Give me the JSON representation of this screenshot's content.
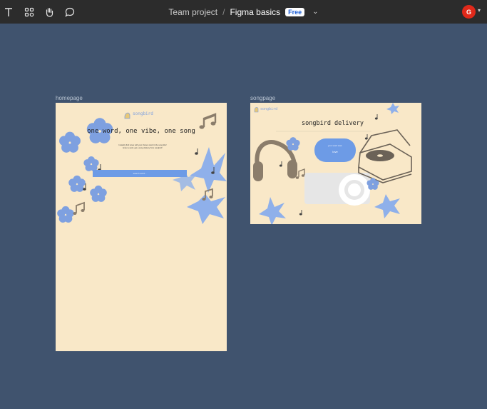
{
  "toolbar": {
    "tools": [
      {
        "name": "text-tool",
        "icon": "text-icon"
      },
      {
        "name": "resources-tool",
        "icon": "resources-icon"
      },
      {
        "name": "hand-tool",
        "icon": "hand-icon"
      },
      {
        "name": "comment-tool",
        "icon": "comment-icon"
      }
    ],
    "breadcrumb": {
      "team": "Team project",
      "separator": "/",
      "file": "Figma basics",
      "badge": "Free"
    },
    "avatar_initial": "G",
    "avatar_color": "#e0291a"
  },
  "frames": {
    "homepage": {
      "label": "homepage",
      "logo": "songbird",
      "title": "one word, one vibe, one song",
      "description_line1": "Instantly find tunes with your chosen word in the song title!",
      "description_line2": "Enter a word, get a song delivery from songbird!",
      "search_placeholder": "search word..."
    },
    "songpage": {
      "label": "songpage",
      "logo": "songbird",
      "title": "songbird delivery",
      "bubble_text": "your word was:",
      "bubble_word": "love"
    }
  },
  "colors": {
    "canvas": "#40536e",
    "toolbar": "#2c2c2c",
    "frame_bg": "#f9e8c8",
    "flower_blue": "#7ea0e0",
    "accent_blue": "#6d9be6",
    "brown": "#8b7d6b"
  }
}
